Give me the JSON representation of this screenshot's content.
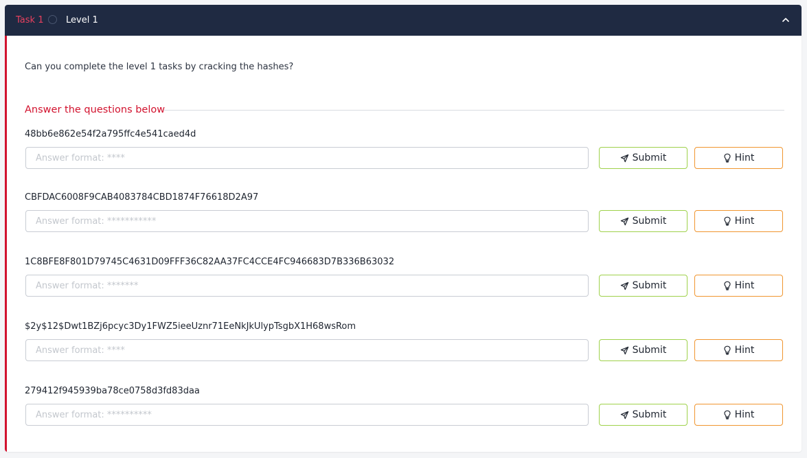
{
  "header": {
    "task_label": "Task 1",
    "task_title": "Level 1"
  },
  "intro": "Can you complete the level 1 tasks by cracking the hashes?",
  "answer_heading": "Answer the questions below",
  "buttons": {
    "submit": "Submit",
    "hint": "Hint"
  },
  "questions": [
    {
      "text": "48bb6e862e54f2a795ffc4e541caed4d",
      "placeholder": "Answer format: ****"
    },
    {
      "text": "CBFDAC6008F9CAB4083784CBD1874F76618D2A97",
      "placeholder": "Answer format: ***********"
    },
    {
      "text": "1C8BFE8F801D79745C4631D09FFF36C82AA37FC4CCE4FC946683D7B336B63032",
      "placeholder": "Answer format: *******"
    },
    {
      "text": "$2y$12$Dwt1BZj6pcyc3Dy1FWZ5ieeUznr71EeNkJkUlypTsgbX1H68wsRom",
      "placeholder": "Answer format: ****"
    },
    {
      "text": "279412f945939ba78ce0758d3fd83daa",
      "placeholder": "Answer format: **********"
    }
  ],
  "colors": {
    "header_bg": "#1f2a42",
    "accent_red": "#d2122e",
    "submit_border": "#9ed14a",
    "hint_border": "#f0952e"
  },
  "icons": {
    "collapse": "chevron-up-icon",
    "status": "circle-outline-icon",
    "submit": "paper-plane-icon",
    "hint": "lightbulb-icon"
  }
}
